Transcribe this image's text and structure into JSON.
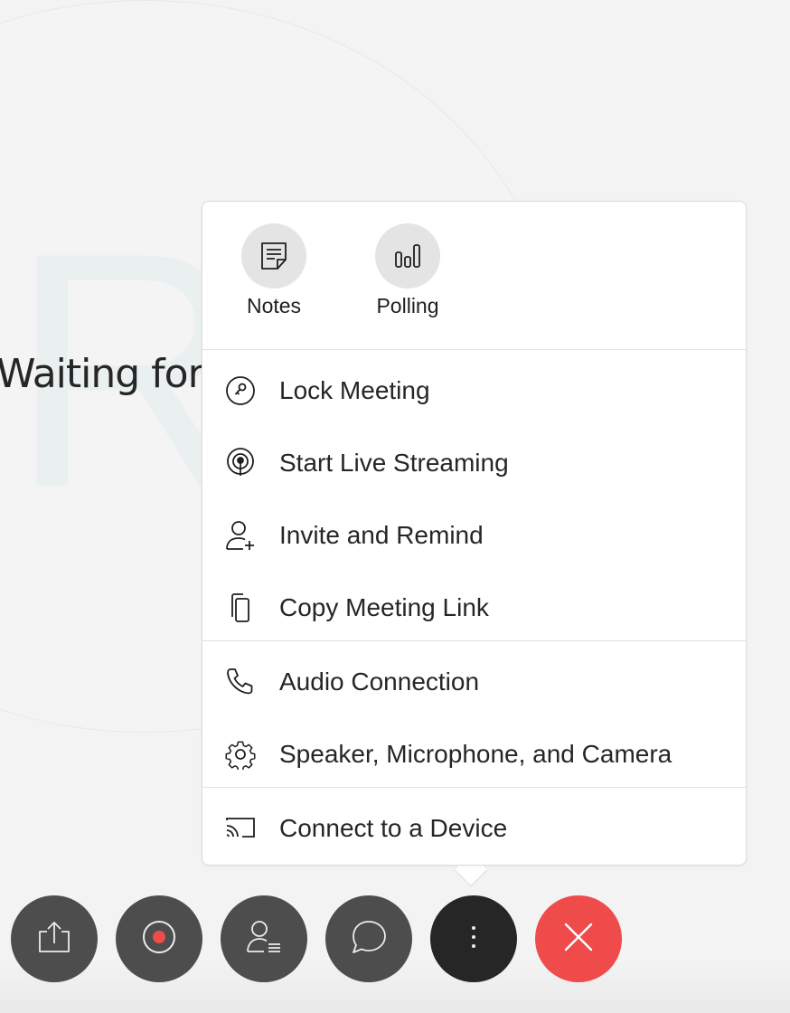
{
  "background": {
    "avatar_letter": "R",
    "waiting_text": "Waiting for o"
  },
  "menu": {
    "quick_actions": [
      {
        "label": "Notes",
        "icon": "notes-icon"
      },
      {
        "label": "Polling",
        "icon": "polling-icon"
      }
    ],
    "items": [
      {
        "label": "Lock Meeting",
        "icon": "lock-key-icon"
      },
      {
        "label": "Start Live Streaming",
        "icon": "live-streaming-icon"
      },
      {
        "label": "Invite and Remind",
        "icon": "add-person-icon"
      },
      {
        "label": "Copy Meeting Link",
        "icon": "copy-icon"
      },
      {
        "label": "Audio Connection",
        "icon": "phone-icon"
      },
      {
        "label": "Speaker, Microphone, and Camera",
        "icon": "gear-icon"
      },
      {
        "label": "Connect to a Device",
        "icon": "cast-icon"
      }
    ]
  },
  "toolbar": {
    "buttons": [
      {
        "name": "share",
        "icon": "share-icon"
      },
      {
        "name": "record",
        "icon": "record-icon"
      },
      {
        "name": "participants",
        "icon": "participants-icon"
      },
      {
        "name": "chat",
        "icon": "chat-icon"
      },
      {
        "name": "more",
        "icon": "more-vertical-icon"
      },
      {
        "name": "leave",
        "icon": "close-icon"
      }
    ]
  },
  "colors": {
    "background": "#f3f3f4",
    "button_gray": "#4d4d4d",
    "button_dark": "#262626",
    "leave_red": "#ef4b4b",
    "record_red": "#ef4b4b"
  }
}
